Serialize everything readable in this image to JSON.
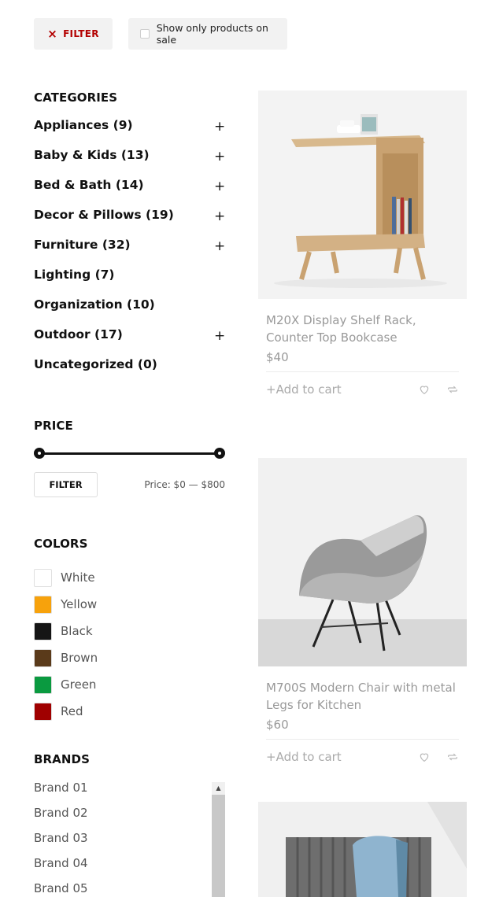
{
  "topbar": {
    "filter_label": "FILTER",
    "filter_icon": "×",
    "sale_label": "Show only products on sale"
  },
  "categories": {
    "title": "CATEGORIES",
    "items": [
      {
        "label": "Appliances (9)",
        "expandable": true
      },
      {
        "label": "Baby & Kids (13)",
        "expandable": true
      },
      {
        "label": "Bed & Bath (14)",
        "expandable": true
      },
      {
        "label": "Decor & Pillows (19)",
        "expandable": true
      },
      {
        "label": "Furniture (32)",
        "expandable": true
      },
      {
        "label": "Lighting (7)",
        "expandable": false
      },
      {
        "label": "Organization (10)",
        "expandable": false
      },
      {
        "label": "Outdoor (17)",
        "expandable": true
      },
      {
        "label": "Uncategorized (0)",
        "expandable": false
      }
    ],
    "expand_icon": "+"
  },
  "price": {
    "title": "PRICE",
    "filter_label": "FILTER",
    "range_label": "Price: $0 — $800",
    "min_fraction": 0,
    "max_fraction": 1
  },
  "colors": {
    "title": "COLORS",
    "items": [
      {
        "label": "White",
        "color": "#ffffff"
      },
      {
        "label": "Yellow",
        "color": "#f7a20c"
      },
      {
        "label": "Black",
        "color": "#151515"
      },
      {
        "label": "Brown",
        "color": "#5a3a1a"
      },
      {
        "label": "Green",
        "color": "#0a9a40"
      },
      {
        "label": "Red",
        "color": "#a00000"
      }
    ]
  },
  "brands": {
    "title": "BRANDS",
    "items": [
      "Brand 01",
      "Brand 02",
      "Brand 03",
      "Brand 04",
      "Brand 05"
    ]
  },
  "products": [
    {
      "title": "M20X Display Shelf Rack, Counter Top Bookcase",
      "price": "$40",
      "add_to_cart": "+Add to cart",
      "image": "shelf-rack"
    },
    {
      "title": "M700S Modern Chair with metal Legs for Kitchen",
      "price": "$60",
      "add_to_cart": "+Add to cart",
      "image": "chair"
    },
    {
      "title": "",
      "price": "",
      "add_to_cart": "",
      "image": "radiator-towel"
    }
  ]
}
